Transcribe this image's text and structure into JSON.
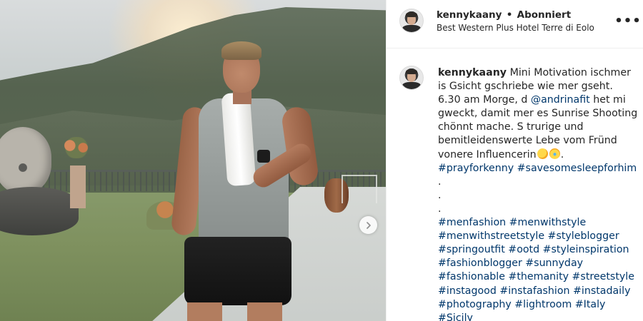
{
  "post": {
    "username": "kennykaany",
    "separator": "•",
    "follow_status": "Abonniert",
    "location": "Best Western Plus Hotel Terre di Eolo",
    "more_icon": "more-horizontal-icon",
    "more_label": "•••"
  },
  "caption": {
    "username": "kennykaany",
    "text_before_mention": " Mini Motivation ischmer is Gsicht gschriebe wie mer gseht. 6.30 am Morge, d ",
    "mention": "@andrinafit",
    "text_after_mention": " het mi gweckt, damit mer es Sunrise Shooting chönnt mache. S trurige und bemitleidenswerte Lebe vom Fründ vonere Influencerin",
    "emojis": [
      "rolling-on-floor-laughing-emoji",
      "crying-laughing-emoji"
    ],
    "text_end": ".",
    "hashtags_first": [
      "#prayforkenny",
      "#savesomesleepforhim"
    ],
    "dots": [
      ".",
      ".",
      "."
    ],
    "hashtag_lines": [
      "#menfashion #menwithstyle",
      "#menwithstreetstyle #styleblogger",
      "#springoutfit #ootd #styleinspiration",
      "#fashionblogger #sunnyday",
      "#fashionable #themanity #streetstyle",
      "#instagood #instafashion #instadaily",
      "#photography #lightroom #Italy",
      "#Sicily"
    ]
  },
  "media": {
    "next_icon": "chevron-right-icon"
  }
}
